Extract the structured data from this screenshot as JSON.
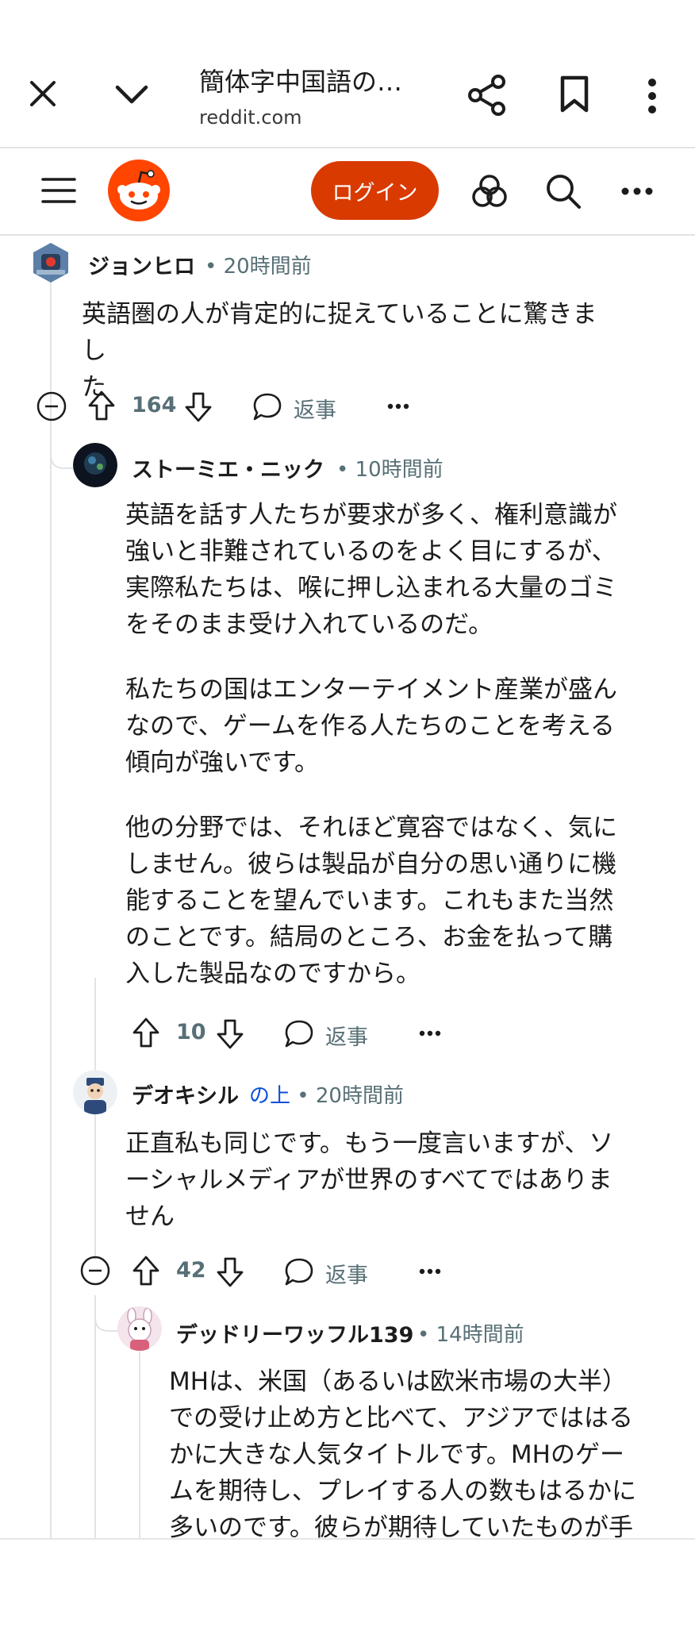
{
  "browser": {
    "page_title": "簡体字中国語の…",
    "domain": "reddit.com"
  },
  "header": {
    "login_label": "ログイン"
  },
  "colors": {
    "brand": "#d93a00",
    "meta_text": "#576f76",
    "link_blue": "#0a4fd8"
  },
  "comments": [
    {
      "author": "ジョンヒロ",
      "time": "• 20時間前",
      "body_lines": [
        "英語圏の人が肯定的に捉えていることに驚きまし",
        "た"
      ],
      "votes": "164",
      "reply": "返事"
    },
    {
      "author": "ストーミエ・ニック",
      "time": "• 10時間前",
      "paragraphs": [
        [
          "英語を話す人たちが要求が多く、権利意識が",
          "強いと非難されているのをよく目にするが、",
          "実際私たちは、喉に押し込まれる大量のゴミ",
          "をそのまま受け入れているのだ。"
        ],
        [
          "私たちの国はエンターテイメント産業が盛ん",
          "なので、ゲームを作る人たちのことを考える",
          "傾向が強いです。"
        ],
        [
          "他の分野では、それほど寛容ではなく、気に",
          "しません。彼らは製品が自分の思い通りに機",
          "能することを望んでいます。これもまた当然",
          "のことです。結局のところ、お金を払って購",
          "入した製品なのですから。"
        ]
      ],
      "votes": "10",
      "reply": "返事"
    },
    {
      "author": "デオキシル",
      "above_link": "の上",
      "time": "• 20時間前",
      "body_lines": [
        "正直私も同じです。もう一度言いますが、ソ",
        "ーシャルメディアが世界のすべてではありま",
        "せん"
      ],
      "votes": "42",
      "reply": "返事"
    },
    {
      "author": "デッドリーワッフル139",
      "time": "• 14時間前",
      "body_lines": [
        "MHは、米国（あるいは欧米市場の大半）",
        "での受け止め方と比べて、アジアでははる",
        "かに大きな人気タイトルです。MHのゲー",
        "ムを期待し、プレイする人の数もはるかに",
        "多いのです。彼らが期待していたものが手"
      ]
    }
  ]
}
